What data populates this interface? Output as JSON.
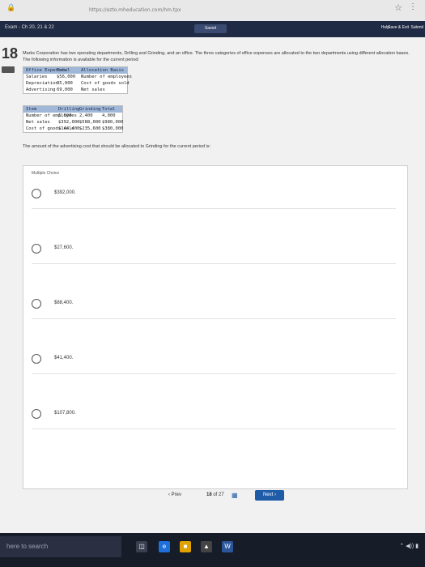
{
  "browser": {
    "url": "https://ezto.mheducation.com/hm.tpx",
    "tab_icon": "lock-icon"
  },
  "exam": {
    "title": "Exam - Ch 20, 21 & 22",
    "timer_label": "Saved",
    "help": "Help",
    "save_exit": "Save & Exit",
    "submit": "Submit"
  },
  "question": {
    "number": "18",
    "text": "Marks Corporation has two operating departments, Drilling and Grinding, and an office. The three categories of office expenses are allocated to the two departments using different allocation bases. The following information is available for the current period:",
    "expenses_table": {
      "headers": [
        "Office Expenses",
        "Total",
        "Allocation Basis"
      ],
      "rows": [
        [
          "Salaries",
          "$56,000",
          "Number of employees"
        ],
        [
          "Depreciation",
          "35,000",
          "Cost of goods sold"
        ],
        [
          "Advertising",
          "69,000",
          "Net sales"
        ]
      ]
    },
    "departments_table": {
      "headers": [
        "Item",
        "Drilling",
        "Grinding",
        "Total"
      ],
      "rows": [
        [
          "Number of employees",
          "1,600",
          "2,400",
          "4,000"
        ],
        [
          "Net sales",
          "$392,000",
          "$588,000",
          "$980,000"
        ],
        [
          "Cost of goods sold",
          "$144,400",
          "$235,600",
          "$380,000"
        ]
      ]
    },
    "prompt": "The amount of the advertising cost that should be allocated to Grinding for the current period is:",
    "mc_label": "Multiple Choice",
    "options": [
      "$392,000.",
      "$27,600.",
      "$88,400.",
      "$41,400.",
      "$107,800."
    ]
  },
  "nav": {
    "prev": "Prev",
    "page_current": "18",
    "page_of": "of 27",
    "next": "Next"
  },
  "taskbar": {
    "search_placeholder": "here to search"
  }
}
